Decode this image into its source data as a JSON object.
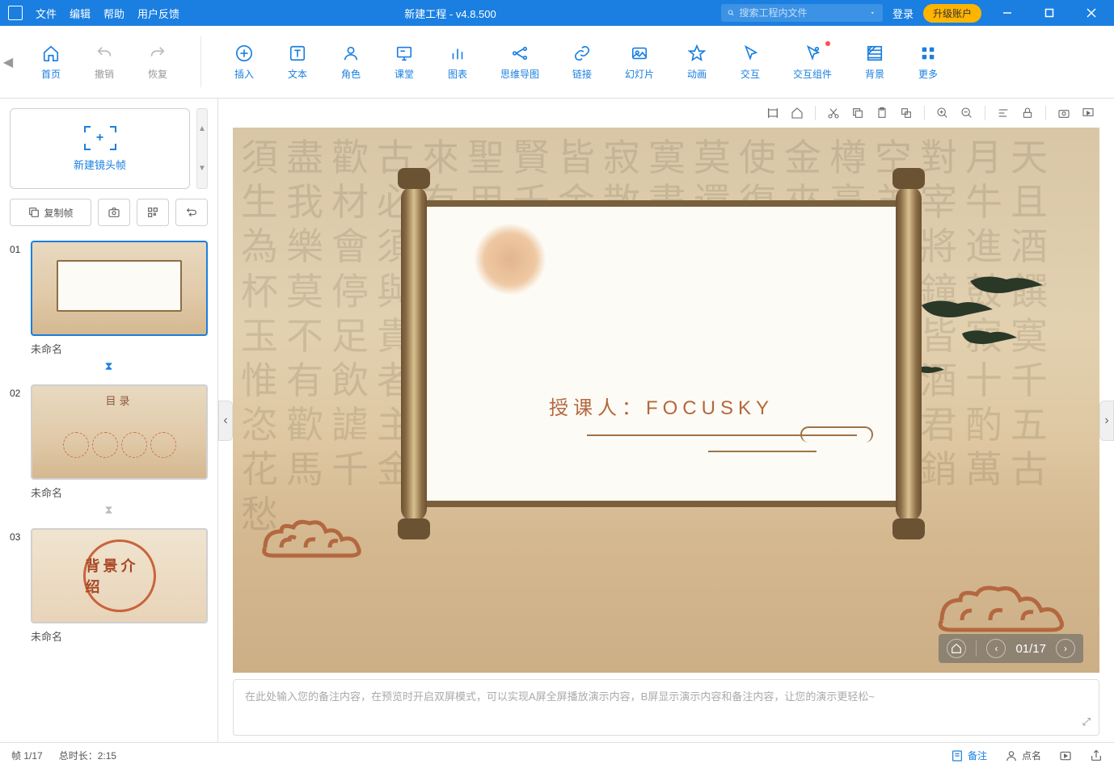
{
  "titlebar": {
    "menus": [
      "文件",
      "编辑",
      "帮助",
      "用户反馈"
    ],
    "title": "新建工程 - v4.8.500",
    "search_placeholder": "搜索工程内文件",
    "login": "登录",
    "upgrade": "升级账户"
  },
  "toolbar": {
    "nav": [
      {
        "label": "首页",
        "icon": "home"
      },
      {
        "label": "撤销",
        "icon": "undo"
      },
      {
        "label": "恢复",
        "icon": "redo"
      }
    ],
    "main": [
      {
        "label": "插入",
        "icon": "plus"
      },
      {
        "label": "文本",
        "icon": "text"
      },
      {
        "label": "角色",
        "icon": "person"
      },
      {
        "label": "课堂",
        "icon": "board"
      },
      {
        "label": "图表",
        "icon": "chart"
      },
      {
        "label": "思维导图",
        "icon": "mindmap"
      },
      {
        "label": "链接",
        "icon": "link"
      },
      {
        "label": "幻灯片",
        "icon": "slides"
      },
      {
        "label": "动画",
        "icon": "star"
      },
      {
        "label": "交互",
        "icon": "cursor"
      },
      {
        "label": "交互组件",
        "icon": "component",
        "notify": true
      },
      {
        "label": "背景",
        "icon": "pattern"
      },
      {
        "label": "更多",
        "icon": "more"
      }
    ]
  },
  "sidebar": {
    "new_frame": "新建镜头帧",
    "copy_frame": "复制帧",
    "slides": [
      {
        "num": "01",
        "label": "未命名",
        "active": true
      },
      {
        "num": "02",
        "label": "未命名",
        "active": false,
        "content": "目录"
      },
      {
        "num": "03",
        "label": "未命名",
        "active": false,
        "content": "背景介绍"
      }
    ]
  },
  "canvas": {
    "slide_text": "授课人：FOCUSKY",
    "nav_counter": "01/17"
  },
  "notes": {
    "placeholder": "在此处输入您的备注内容，在预览时开启双屏模式，可以实现A屏全屏播放演示内容，B屏显示演示内容和备注内容，让您的演示更轻松~"
  },
  "statusbar": {
    "frame": "帧 1/17",
    "duration": "总时长：2:15",
    "notes": "备注",
    "roll": "点名"
  }
}
